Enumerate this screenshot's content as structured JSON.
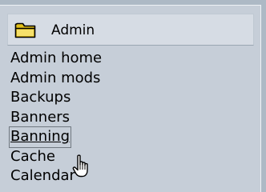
{
  "header": {
    "title": "Admin",
    "icon": "folder-icon",
    "icon_color": "#f4d020"
  },
  "menu": {
    "items": [
      {
        "label": "Admin home"
      },
      {
        "label": "Admin mods"
      },
      {
        "label": "Backups"
      },
      {
        "label": "Banners"
      },
      {
        "label": "Banning",
        "hovered": true
      },
      {
        "label": "Cache"
      },
      {
        "label": "Calendar"
      }
    ]
  },
  "cursor": {
    "icon": "hand-pointer-icon"
  },
  "colors": {
    "background": "#adb9c5",
    "panel": "#c6ced8",
    "header": "#d6dce4"
  }
}
